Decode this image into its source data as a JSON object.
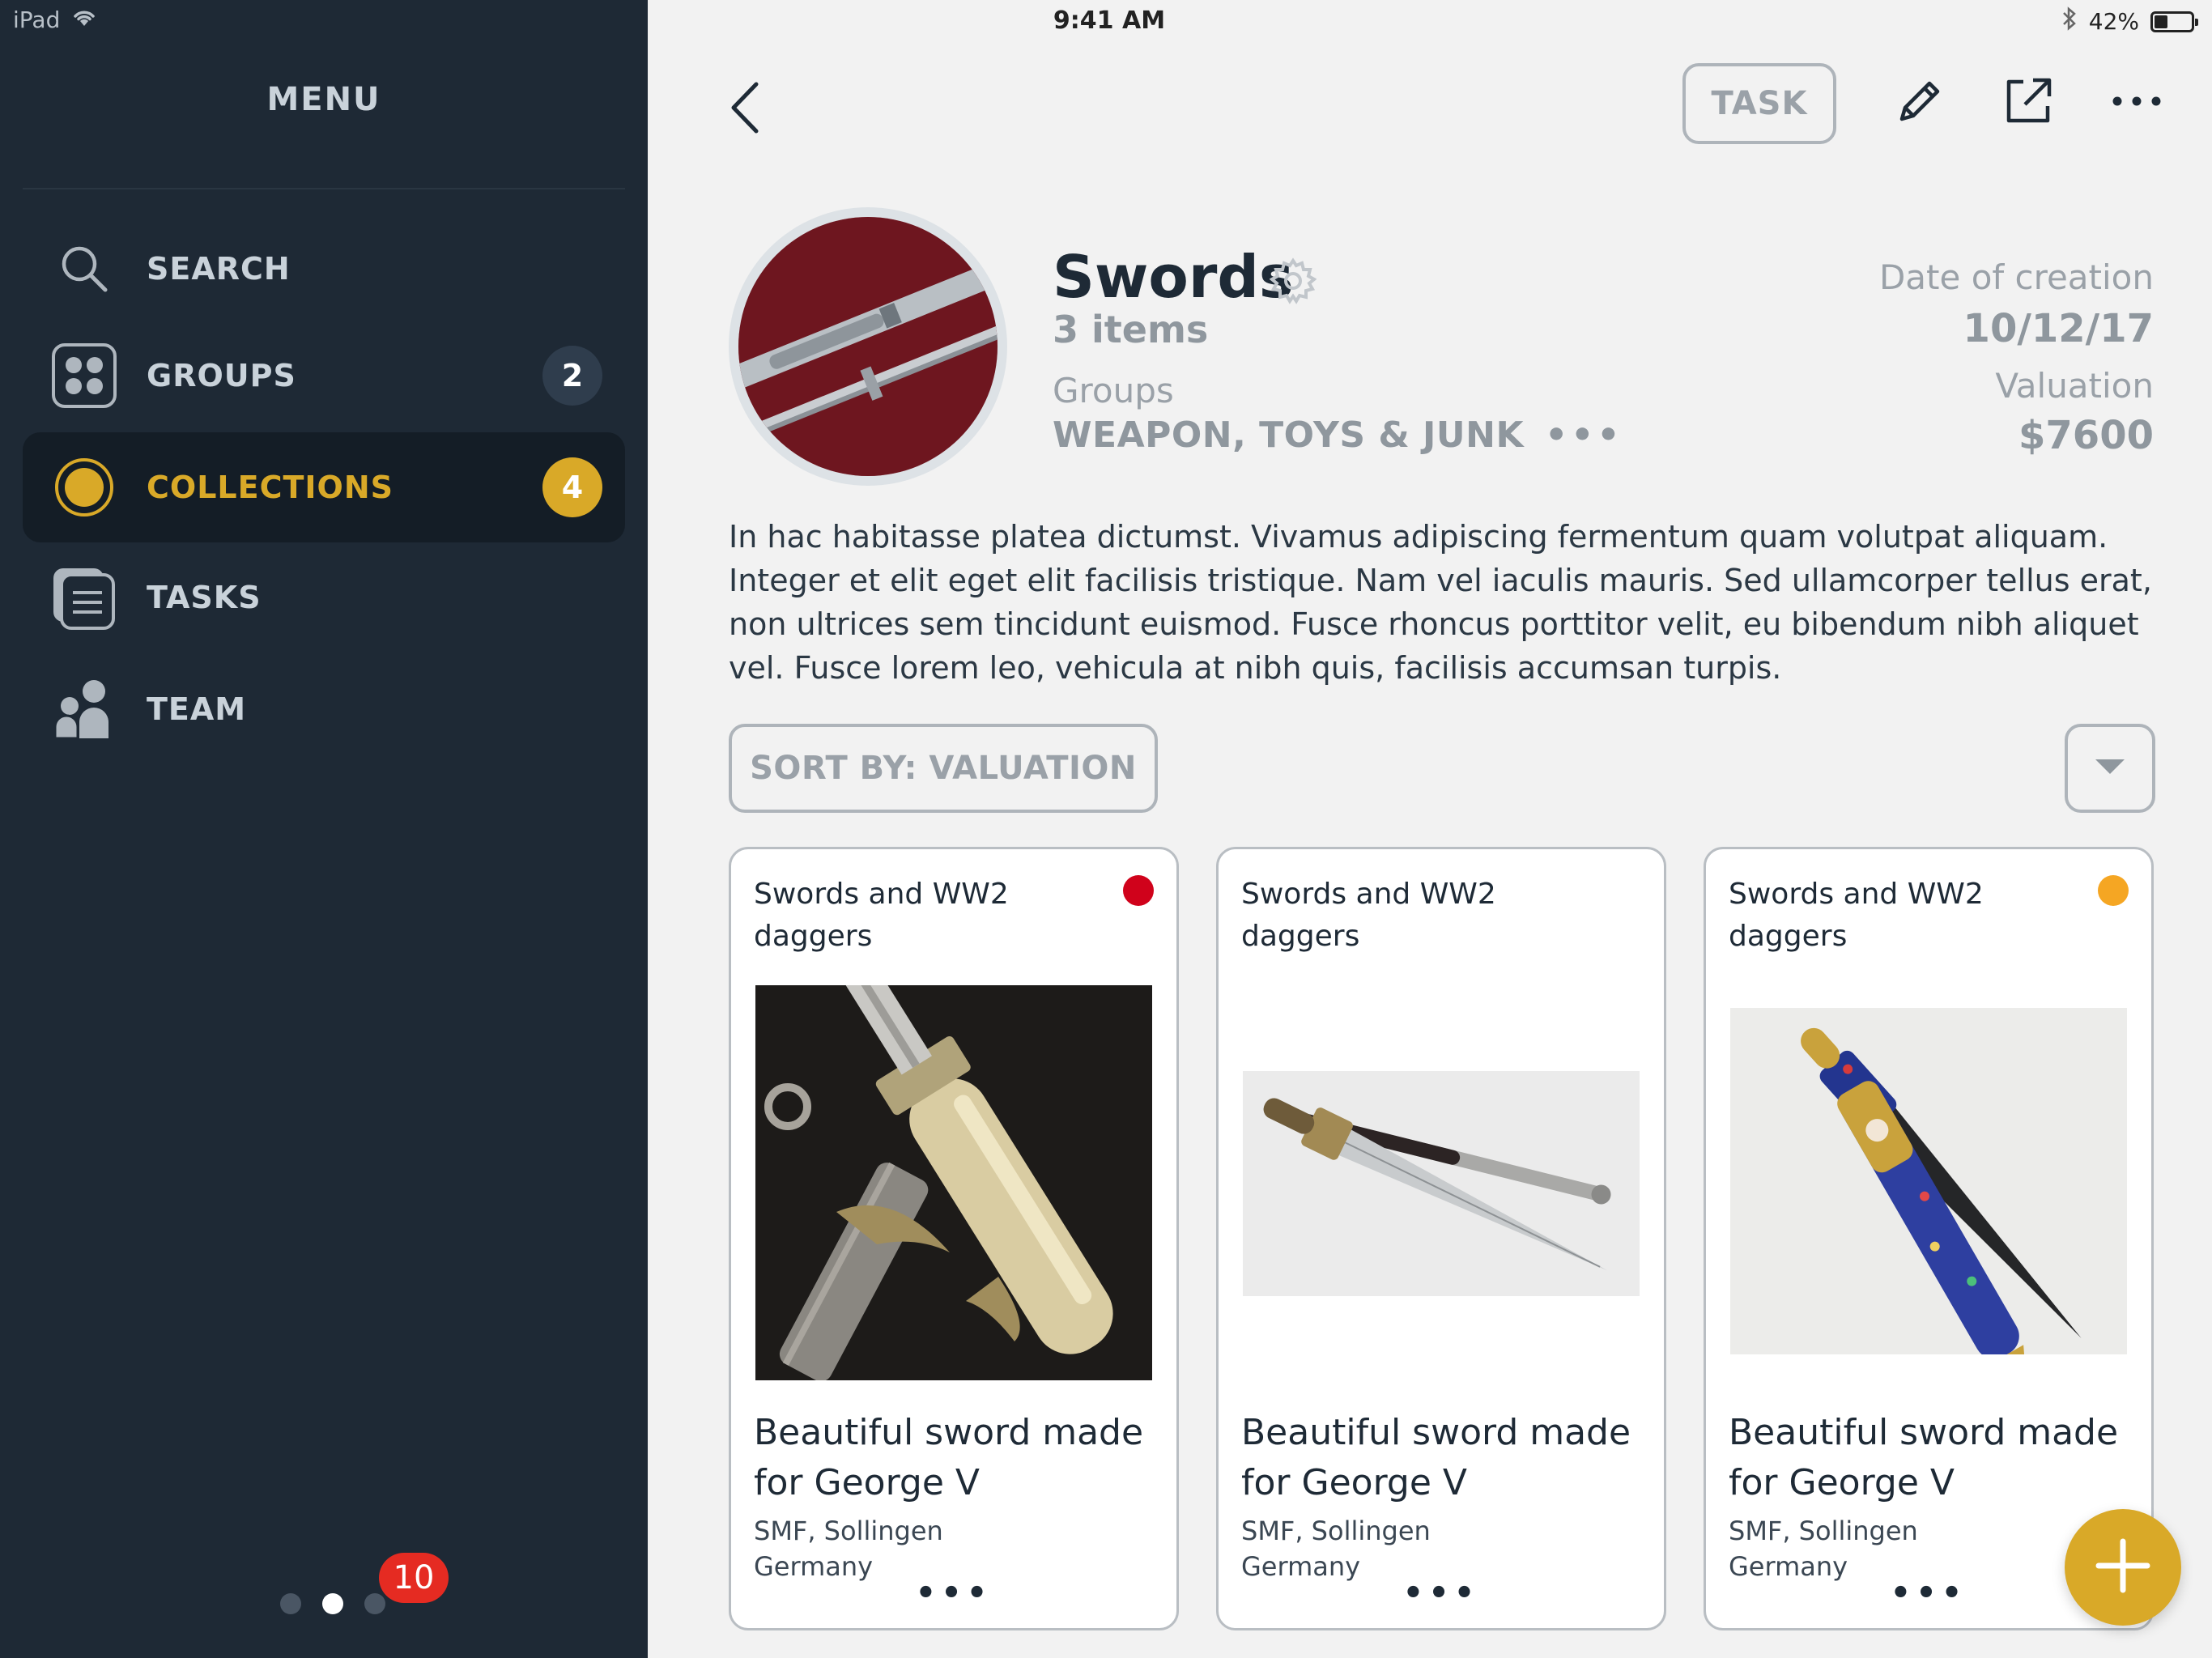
{
  "status_bar": {
    "device": "iPad",
    "time": "9:41 AM",
    "battery": "42%",
    "battery_level": 0.42
  },
  "sidebar": {
    "title": "MENU",
    "items": [
      {
        "label": "SEARCH",
        "icon": "search-icon",
        "badge": null
      },
      {
        "label": "GROUPS",
        "icon": "groups-icon",
        "badge": "2"
      },
      {
        "label": "COLLECTIONS",
        "icon": "collections-icon",
        "badge": "4",
        "active": true
      },
      {
        "label": "TASKS",
        "icon": "tasks-icon",
        "badge": null
      },
      {
        "label": "TEAM",
        "icon": "team-icon",
        "badge": null
      }
    ],
    "page_indicator": {
      "count": 3,
      "current": 2
    },
    "notification_count": "10"
  },
  "toolbar": {
    "task_label": "TASK",
    "icons": [
      "back-icon",
      "pencil-icon",
      "share-icon",
      "more-icon"
    ]
  },
  "collection": {
    "title": "Swords",
    "count": "3 items",
    "groups_label": "Groups",
    "groups_value": "WEAPON, TOYS & JUNK",
    "groups_more": "•••",
    "date_label": "Date of creation",
    "date_value": "10/12/17",
    "valuation_label": "Valuation",
    "valuation_value": "$7600",
    "description": "In hac habitasse platea dictumst. Vivamus adipiscing fermentum quam volutpat aliquam. Integer et elit eget elit facilisis tristique. Nam vel iaculis mauris. Sed ullamcorper tellus erat, non ultrices sem tincidunt euismod. Fusce rhoncus porttitor velit, eu bibendum nibh aliquet vel. Fusce lorem leo, vehicula at nibh quis, facilisis accumsan turpis."
  },
  "sort": {
    "label": "SORT BY: VALUATION"
  },
  "cards": [
    {
      "title": "Swords and WW2 daggers",
      "status_color": "#d0021b",
      "name": "Beautiful sword made for George V",
      "maker_line1": "SMF, Sollingen",
      "maker_line2": "Germany",
      "more": "•••"
    },
    {
      "title": "Swords and WW2 daggers",
      "status_color": null,
      "name": "Beautiful sword made for George V",
      "maker_line1": "SMF, Sollingen",
      "maker_line2": "Germany",
      "more": "•••"
    },
    {
      "title": "Swords and WW2 daggers",
      "status_color": "#f5a623",
      "name": "Beautiful sword made for George V",
      "maker_line1": "SMF, Sollingen",
      "maker_line2": "Germany",
      "more": "•••"
    }
  ],
  "colors": {
    "accent": "#d9a928",
    "sidebar_bg": "#1e2935",
    "alert": "#e52b22"
  }
}
